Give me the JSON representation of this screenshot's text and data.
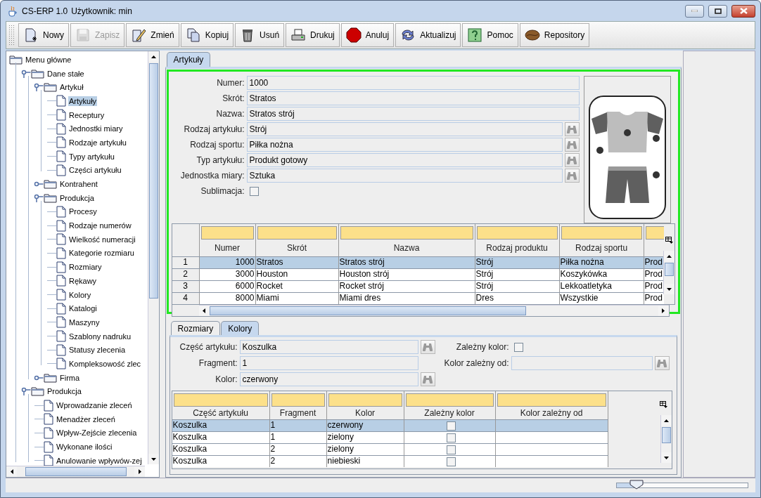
{
  "window": {
    "app_name": "CS-ERP 1.0",
    "user": "Użytkownik: min"
  },
  "toolbar": [
    {
      "label": "Nowy",
      "disabled": false
    },
    {
      "label": "Zapisz",
      "disabled": true
    },
    {
      "label": "Zmień",
      "disabled": false
    },
    {
      "label": "Kopiuj",
      "disabled": false
    },
    {
      "label": "Usuń",
      "disabled": false
    },
    {
      "label": "Drukuj",
      "disabled": false
    },
    {
      "label": "Anuluj",
      "disabled": false
    },
    {
      "label": "Aktualizuj",
      "disabled": false
    },
    {
      "label": "Pomoc",
      "disabled": false
    },
    {
      "label": "Repository",
      "disabled": false
    }
  ],
  "tree": [
    {
      "label": "Menu główne",
      "kind": "folder",
      "expanded": true,
      "selected": false,
      "children": [
        {
          "label": "Dane stałe",
          "kind": "folder",
          "expanded": true,
          "selected": false,
          "children": [
            {
              "label": "Artykuł",
              "kind": "folder",
              "expanded": true,
              "selected": false,
              "children": [
                {
                  "label": "Artykuły",
                  "kind": "document",
                  "selected": true
                },
                {
                  "label": "Receptury",
                  "kind": "document",
                  "selected": false
                },
                {
                  "label": "Jednostki miary",
                  "kind": "document",
                  "selected": false
                },
                {
                  "label": "Rodzaje artykułu",
                  "kind": "document",
                  "selected": false
                },
                {
                  "label": "Typy artykułu",
                  "kind": "document",
                  "selected": false
                },
                {
                  "label": "Części artykułu",
                  "kind": "document",
                  "selected": false
                }
              ]
            },
            {
              "label": "Kontrahent",
              "kind": "folder",
              "expanded": false,
              "selected": false
            },
            {
              "label": "Produkcja",
              "kind": "folder",
              "expanded": true,
              "selected": false,
              "children": [
                {
                  "label": "Procesy",
                  "kind": "document",
                  "selected": false
                },
                {
                  "label": "Rodzaje numerów",
                  "kind": "document",
                  "selected": false
                },
                {
                  "label": "Wielkość numeracji",
                  "kind": "document",
                  "selected": false
                },
                {
                  "label": "Kategorie rozmiaru",
                  "kind": "document",
                  "selected": false
                },
                {
                  "label": "Rozmiary",
                  "kind": "document",
                  "selected": false
                },
                {
                  "label": "Rękawy",
                  "kind": "document",
                  "selected": false
                },
                {
                  "label": "Kolory",
                  "kind": "document",
                  "selected": false
                },
                {
                  "label": "Katalogi",
                  "kind": "document",
                  "selected": false
                },
                {
                  "label": "Maszyny",
                  "kind": "document",
                  "selected": false
                },
                {
                  "label": "Szablony nadruku",
                  "kind": "document",
                  "selected": false
                },
                {
                  "label": "Statusy zlecenia",
                  "kind": "document",
                  "selected": false
                },
                {
                  "label": "Kompleksowość zlec",
                  "kind": "document",
                  "selected": false
                }
              ]
            },
            {
              "label": "Firma",
              "kind": "folder",
              "expanded": false,
              "selected": false
            }
          ]
        },
        {
          "label": "Produkcja",
          "kind": "folder",
          "expanded": true,
          "selected": false,
          "children": [
            {
              "label": "Wprowadzanie zleceń",
              "kind": "document",
              "selected": false
            },
            {
              "label": "Menadżer zleceń",
              "kind": "document",
              "selected": false
            },
            {
              "label": "Wpływ-Zejście zlecenia",
              "kind": "document",
              "selected": false
            },
            {
              "label": "Wykonane ilości",
              "kind": "document",
              "selected": false
            },
            {
              "label": "Anulowanie wpływów-zej",
              "kind": "document",
              "selected": false
            }
          ]
        }
      ]
    }
  ],
  "main_tabs": [
    {
      "label": "Artykuły",
      "selected": true
    }
  ],
  "article_form": {
    "fields": [
      {
        "label": "Numer:",
        "value": "1000",
        "lookup": false
      },
      {
        "label": "Skrót:",
        "value": "Stratos",
        "lookup": false
      },
      {
        "label": "Nazwa:",
        "value": "Stratos strój",
        "lookup": false
      },
      {
        "label": "Rodzaj artykułu:",
        "value": "Strój",
        "lookup": true
      },
      {
        "label": "Rodzaj sportu:",
        "value": "Piłka nożna",
        "lookup": true
      },
      {
        "label": "Typ artykułu:",
        "value": "Produkt gotowy",
        "lookup": true
      },
      {
        "label": "Jednostka miary:",
        "value": "Sztuka",
        "lookup": true
      }
    ],
    "sublimacja": {
      "label": "Sublimacja:",
      "checked": false
    }
  },
  "articles_table": {
    "columns": [
      "Numer",
      "Skrót",
      "Nazwa",
      "Rodzaj produktu",
      "Rodzaj sportu"
    ],
    "rows": [
      {
        "number": "1",
        "selected": true,
        "cells": [
          "1000",
          "Stratos",
          "Stratos strój",
          "Strój",
          "Piłka nożna",
          "Prod"
        ]
      },
      {
        "number": "2",
        "selected": false,
        "cells": [
          "3000",
          "Houston",
          "Houston strój",
          "Strój",
          "Koszykówka",
          "Prod"
        ]
      },
      {
        "number": "3",
        "selected": false,
        "cells": [
          "6000",
          "Rocket",
          "Rocket strój",
          "Strój",
          "Lekkoatletyka",
          "Prod"
        ]
      },
      {
        "number": "4",
        "selected": false,
        "cells": [
          "8000",
          "Miami",
          "Miami dres",
          "Dres",
          "Wszystkie",
          "Prod"
        ]
      }
    ]
  },
  "detail_tabs": [
    {
      "label": "Rozmiary",
      "selected": false
    },
    {
      "label": "Kolory",
      "selected": true
    }
  ],
  "color_form": {
    "left": [
      {
        "label": "Część artykułu:",
        "value": "Koszulka",
        "lookup": true
      },
      {
        "label": "Fragment:",
        "value": "1",
        "lookup": false
      },
      {
        "label": "Kolor:",
        "value": "czerwony",
        "lookup": true
      }
    ],
    "dependent": {
      "label": "Zależny kolor:",
      "checked": false
    },
    "depends_on": {
      "label": "Kolor zależny od:",
      "lookup": true
    }
  },
  "colors_table": {
    "columns": [
      "Część artykułu",
      "Fragment",
      "Kolor",
      "Zależny kolor",
      "Kolor zależny od"
    ],
    "rows": [
      {
        "part": "Koszulka",
        "fragment": "1",
        "kolor": "czerwony",
        "dependent": false,
        "selected": true
      },
      {
        "part": "Koszulka",
        "fragment": "1",
        "kolor": "zielony",
        "dependent": false,
        "selected": false
      },
      {
        "part": "Koszulka",
        "fragment": "2",
        "kolor": "zielony",
        "dependent": false,
        "selected": false
      },
      {
        "part": "Koszulka",
        "fragment": "2",
        "kolor": "niebieski",
        "dependent": false,
        "selected": false
      }
    ]
  },
  "status_bar": {
    "zoom_slider": {
      "level": 0.15
    }
  }
}
